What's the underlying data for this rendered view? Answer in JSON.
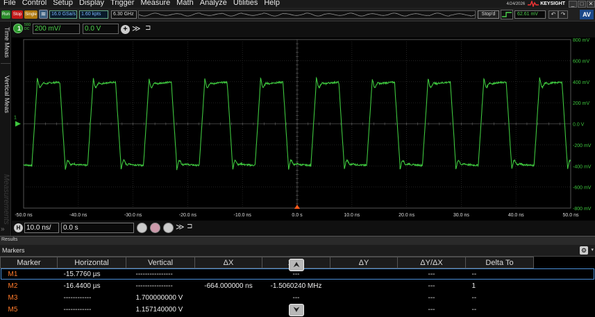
{
  "menu": [
    "File",
    "Control",
    "Setup",
    "Display",
    "Trigger",
    "Measure",
    "Math",
    "Analyze",
    "Utilities",
    "Help"
  ],
  "header": {
    "date": "4/24/2026",
    "brand": "KEYSIGHT",
    "brand_sub": "TECHNOLOGIES"
  },
  "toolbar": {
    "run": "Run",
    "stop": "Stop",
    "single": "Single",
    "sample_rate": "16.0 GSa/s",
    "points": "1.60 kpts",
    "bandwidth": "6.30 GHz",
    "status": "Stop'd",
    "trigger_level": "62.61 mV",
    "undo": "↶",
    "redo": "↷",
    "av": "AV"
  },
  "side_tabs": {
    "time_meas": "Time Meas",
    "vertical_meas": "Vertical Meas",
    "measurements": "Measurements"
  },
  "channel": {
    "number": "1",
    "coupling_top": "50Ω",
    "coupling_bottom": "DC",
    "scale": "200 mV/",
    "offset": "0.0 V",
    "add": "+",
    "more": "≫",
    "pin": "⊐"
  },
  "horizontal": {
    "badge": "H",
    "scale": "10.0 ns/",
    "position": "0.0 s",
    "more": "≫",
    "pin": "⊐"
  },
  "waveform": {
    "x_labels": [
      "-50.0 ns",
      "-40.0 ns",
      "-30.0 ns",
      "-20.0 ns",
      "-10.0 ns",
      "0.0 s",
      "10.0 ns",
      "20.0 ns",
      "30.0 ns",
      "40.0 ns",
      "50.0 ns"
    ],
    "y_labels": [
      "800 mV",
      "600 mV",
      "400 mV",
      "200 mV",
      "0.0 V",
      "-200 mV",
      "-400 mV",
      "-600 mV",
      "-800 mV"
    ],
    "channel_marker": "1",
    "trace_color": "#3ec63e",
    "period_ns": 10.2,
    "high_mv": 400,
    "low_mv": -400
  },
  "results": {
    "label": "Results",
    "panel_title": "Markers",
    "gear": "⚙"
  },
  "markers_table": {
    "columns": [
      "Marker",
      "Horizontal",
      "Vertical",
      "ΔX",
      "1/ΔX",
      "ΔY",
      "ΔY/ΔX",
      "Delta To"
    ],
    "rows": [
      [
        "M1",
        "-15.7760 µs",
        "----------------",
        "",
        "---",
        "",
        "---",
        "--"
      ],
      [
        "M2",
        "-16.4400 µs",
        "----------------",
        "-664.000000 ns",
        "-1.5060240 MHz",
        "",
        "---",
        "1"
      ],
      [
        "M3",
        "------------",
        "1.700000000 V",
        "",
        "---",
        "",
        "---",
        "--"
      ],
      [
        "M5",
        "------------",
        "1.157140000 V",
        "",
        "---",
        "",
        "---",
        "--"
      ]
    ]
  },
  "scroll": {
    "up": "⮝",
    "down": "⮟"
  }
}
